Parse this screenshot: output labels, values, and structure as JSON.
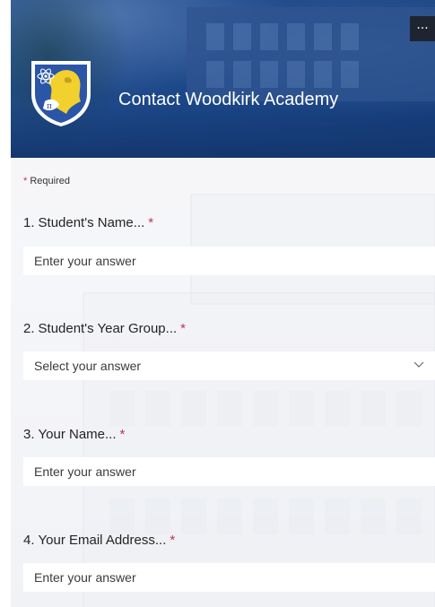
{
  "header": {
    "title": "Contact Woodkirk Academy",
    "more_label": "···",
    "colors": {
      "banner": "#1f4a86",
      "crest_shield": "#2b56a8",
      "crest_lion": "#f2d02e"
    }
  },
  "form": {
    "required_asterisk": "*",
    "required_label": "Required",
    "questions": [
      {
        "number": "1.",
        "label": "Student's Name...",
        "required": "*",
        "type": "text",
        "placeholder": "Enter your answer"
      },
      {
        "number": "2.",
        "label": "Student's Year Group...",
        "required": "*",
        "type": "select",
        "placeholder": "Select your answer"
      },
      {
        "number": "3.",
        "label": "Your Name...",
        "required": "*",
        "type": "text",
        "placeholder": "Enter your answer"
      },
      {
        "number": "4.",
        "label": "Your Email Address...",
        "required": "*",
        "type": "text",
        "placeholder": "Enter your answer"
      }
    ]
  },
  "icons": {
    "crest": "school-crest-icon",
    "more": "more-options-icon",
    "chevron": "chevron-down-icon"
  },
  "colors": {
    "required_asterisk": "#c4314b",
    "input_background": "#ffffff",
    "text": "#242424"
  }
}
